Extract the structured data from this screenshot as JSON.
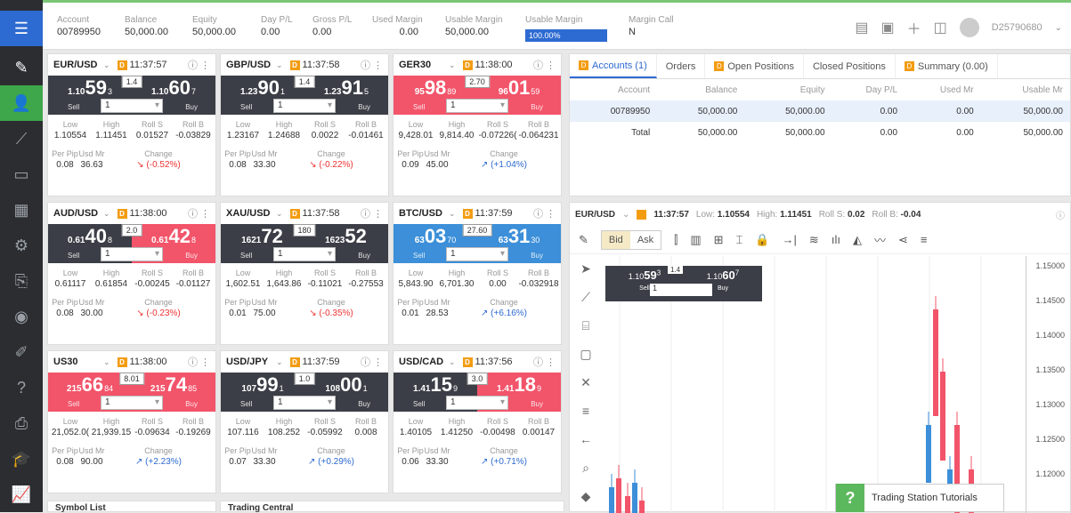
{
  "topbar": {
    "fields": [
      {
        "label": "Account",
        "value": "00789950"
      },
      {
        "label": "Balance",
        "value": "50,000.00"
      },
      {
        "label": "Equity",
        "value": "50,000.00"
      },
      {
        "label": "Day P/L",
        "value": "0.00"
      },
      {
        "label": "Gross P/L",
        "value": "0.00"
      },
      {
        "label": "Used Margin",
        "value": "0.00"
      },
      {
        "label": "Usable Margin",
        "value": "50,000.00"
      },
      {
        "label": "Usable Margin",
        "value": "100.00%"
      },
      {
        "label": "Margin Call",
        "value": "N"
      }
    ],
    "account_id": "D25790680"
  },
  "cards": [
    {
      "symbol": "EUR/USD",
      "time": "11:37:57",
      "theme": "dark",
      "sell": {
        "sm": "1.10",
        "big": "59",
        "sup": "3"
      },
      "buy": {
        "sm": "1.10",
        "big": "60",
        "sup": "7"
      },
      "spread": "1.4",
      "amount": "1",
      "low": "1.10554",
      "high": "1.11451",
      "rolls": "0.01527",
      "rollb": "-0.03829",
      "perpip": "0.08",
      "usdmr": "36.63",
      "change": "(-0.52%)",
      "dir": "neg"
    },
    {
      "symbol": "GBP/USD",
      "time": "11:37:58",
      "theme": "dark",
      "sell": {
        "sm": "1.23",
        "big": "90",
        "sup": "1"
      },
      "buy": {
        "sm": "1.23",
        "big": "91",
        "sup": "5"
      },
      "spread": "1.4",
      "amount": "1",
      "low": "1.23167",
      "high": "1.24688",
      "rolls": "0.0022",
      "rollb": "-0.01461",
      "perpip": "0.08",
      "usdmr": "33.30",
      "change": "(-0.22%)",
      "dir": "neg"
    },
    {
      "symbol": "GER30",
      "time": "11:38:00",
      "theme": "red",
      "sell": {
        "sm": "95",
        "big": "98",
        "sup": "89"
      },
      "buy": {
        "sm": "96",
        "big": "01",
        "sup": "59"
      },
      "spread": "2.70",
      "amount": "1",
      "low": "9,428.01",
      "high": "9,814.40",
      "rolls": "-0.07226(",
      "rollb": "-0.064231",
      "perpip": "0.09",
      "usdmr": "45.00",
      "change": "(+1.04%)",
      "dir": "pos"
    },
    {
      "symbol": "AUD/USD",
      "time": "11:38:00",
      "theme": "dark-red",
      "sell": {
        "sm": "0.61",
        "big": "40",
        "sup": "8"
      },
      "buy": {
        "sm": "0.61",
        "big": "42",
        "sup": "8"
      },
      "spread": "2.0",
      "amount": "1",
      "low": "0.61117",
      "high": "0.61854",
      "rolls": "-0.00245",
      "rollb": "-0.01127",
      "perpip": "0.08",
      "usdmr": "30.00",
      "change": "(-0.23%)",
      "dir": "neg"
    },
    {
      "symbol": "XAU/USD",
      "time": "11:37:58",
      "theme": "dark",
      "sell": {
        "sm": "1621",
        "big": "72",
        "sup": ""
      },
      "buy": {
        "sm": "1623",
        "big": "52",
        "sup": ""
      },
      "spread": "180",
      "amount": "1",
      "low": "1,602.51",
      "high": "1,643.86",
      "rolls": "-0.11021",
      "rollb": "-0.27553",
      "perpip": "0.01",
      "usdmr": "75.00",
      "change": "(-0.35%)",
      "dir": "neg"
    },
    {
      "symbol": "BTC/USD",
      "time": "11:37:59",
      "theme": "blue",
      "sell": {
        "sm": "63",
        "big": "03",
        "sup": "70"
      },
      "buy": {
        "sm": "63",
        "big": "31",
        "sup": "30"
      },
      "spread": "27.60",
      "amount": "1",
      "low": "5,843.90",
      "high": "6,701.30",
      "rolls": "0.00",
      "rollb": "-0.032918",
      "perpip": "0.01",
      "usdmr": "28.53",
      "change": "(+6.16%)",
      "dir": "pos"
    },
    {
      "symbol": "US30",
      "time": "11:38:00",
      "theme": "red",
      "sell": {
        "sm": "215",
        "big": "66",
        "sup": "84"
      },
      "buy": {
        "sm": "215",
        "big": "74",
        "sup": "85"
      },
      "spread": "8.01",
      "amount": "1",
      "low": "21,052.0(",
      "high": "21,939.15",
      "rolls": "-0.09634",
      "rollb": "-0.19269",
      "perpip": "0.08",
      "usdmr": "90.00",
      "change": "(+2.23%)",
      "dir": "pos"
    },
    {
      "symbol": "USD/JPY",
      "time": "11:37:59",
      "theme": "dark",
      "sell": {
        "sm": "107",
        "big": "99",
        "sup": "1"
      },
      "buy": {
        "sm": "108",
        "big": "00",
        "sup": "1"
      },
      "spread": "1.0",
      "amount": "1",
      "low": "107.116",
      "high": "108.252",
      "rolls": "-0.05992",
      "rollb": "0.008",
      "perpip": "0.07",
      "usdmr": "33.30",
      "change": "(+0.29%)",
      "dir": "pos"
    },
    {
      "symbol": "USD/CAD",
      "time": "11:37:56",
      "theme": "dark-red",
      "sell": {
        "sm": "1.41",
        "big": "15",
        "sup": "9"
      },
      "buy": {
        "sm": "1.41",
        "big": "18",
        "sup": "9"
      },
      "spread": "3.0",
      "amount": "1",
      "low": "1.40105",
      "high": "1.41250",
      "rolls": "-0.00498",
      "rollb": "0.00147",
      "perpip": "0.06",
      "usdmr": "33.30",
      "change": "(+0.71%)",
      "dir": "pos"
    }
  ],
  "card_labels": {
    "low": "Low",
    "high": "High",
    "rolls": "Roll S",
    "rollb": "Roll B",
    "perpip": "Per Pip",
    "usdmr": "Usd Mr",
    "change": "Change",
    "sell": "Sell",
    "buy": "Buy"
  },
  "bottom": {
    "symbol_list": "Symbol List",
    "trading_central": "Trading Central"
  },
  "account_panel": {
    "tabs": [
      {
        "label": "Accounts (1)",
        "badge": true,
        "active": true
      },
      {
        "label": "Orders",
        "badge": false
      },
      {
        "label": "Open Positions",
        "badge": true
      },
      {
        "label": "Closed Positions",
        "badge": false
      },
      {
        "label": "Summary (0.00)",
        "badge": true
      }
    ],
    "headers": [
      "Account",
      "Balance",
      "Equity",
      "Day P/L",
      "Used Mr",
      "Usable Mr"
    ],
    "rows": [
      [
        "00789950",
        "50,000.00",
        "50,000.00",
        "0.00",
        "0.00",
        "50,000.00"
      ],
      [
        "Total",
        "50,000.00",
        "50,000.00",
        "0.00",
        "0.00",
        "50,000.00"
      ]
    ]
  },
  "chart": {
    "symbol": "EUR/USD",
    "time": "11:37:57",
    "low_label": "Low:",
    "low": "1.10554",
    "high_label": "High:",
    "high": "1.11451",
    "rolls_label": "Roll S:",
    "rolls": "0.02",
    "rollb_label": "Roll B:",
    "rollb": "-0.04",
    "bid": "Bid",
    "ask": "Ask",
    "yticks": [
      "1.15000",
      "1.14500",
      "1.14000",
      "1.13500",
      "1.13000",
      "1.12500",
      "1.12000"
    ],
    "mini": {
      "sell_sm": "1.10",
      "sell_big": "59",
      "sell_sup": "3",
      "buy_sm": "1.10",
      "buy_big": "60",
      "buy_sup": "7",
      "spread": "1.4",
      "amount": "1",
      "sell": "Sell",
      "buy": "Buy"
    }
  },
  "tutorial": "Trading Station Tutorials"
}
